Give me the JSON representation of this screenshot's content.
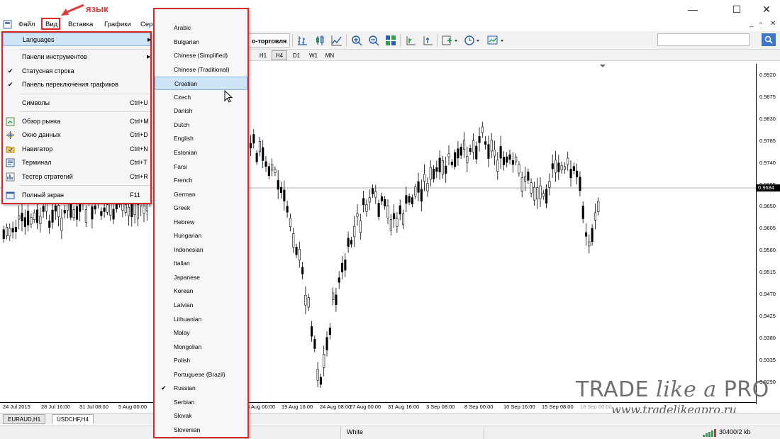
{
  "window": {
    "controls": [
      "—",
      "☐",
      "✕"
    ]
  },
  "menubar": {
    "items": [
      "Файл",
      "Вид",
      "Вставка",
      "Графики",
      "Сер"
    ],
    "mdi_controls": [
      "_",
      "▫",
      "✕"
    ]
  },
  "toolbar": {
    "algo_trading_label": "о-торговля",
    "search_placeholder": ""
  },
  "timeframes": [
    "H1",
    "H4",
    "D1",
    "W1",
    "MN"
  ],
  "active_timeframe": "H4",
  "view_menu": {
    "items": [
      {
        "label": "Languages",
        "shortcut": "",
        "submenu": true,
        "checked": false,
        "highlight": true
      },
      {
        "label": "Панели инструментов",
        "shortcut": "",
        "submenu": true,
        "checked": false
      },
      {
        "label": "Статусная строка",
        "shortcut": "",
        "submenu": false,
        "checked": true
      },
      {
        "label": "Панель переключения графиков",
        "shortcut": "",
        "submenu": false,
        "checked": true
      },
      {
        "label": "Символы",
        "shortcut": "Ctrl+U",
        "submenu": false,
        "checked": false
      },
      {
        "label": "Обзор рынка",
        "shortcut": "Ctrl+M",
        "submenu": false,
        "checked": false,
        "icon": "market-watch-icon"
      },
      {
        "label": "Окно данных",
        "shortcut": "Ctrl+D",
        "submenu": false,
        "checked": false,
        "icon": "data-window-icon"
      },
      {
        "label": "Навигатор",
        "shortcut": "Ctrl+N",
        "submenu": false,
        "checked": false,
        "icon": "navigator-icon"
      },
      {
        "label": "Терминал",
        "shortcut": "Ctrl+T",
        "submenu": false,
        "checked": false,
        "icon": "terminal-icon"
      },
      {
        "label": "Тестер стратегий",
        "shortcut": "Ctrl+R",
        "submenu": false,
        "checked": false,
        "icon": "strategy-tester-icon"
      },
      {
        "label": "Полный экран",
        "shortcut": "F11",
        "submenu": false,
        "checked": false,
        "icon": "fullscreen-icon"
      }
    ]
  },
  "languages_menu": {
    "items": [
      "Arabic",
      "Bulgarian",
      "Chinese (Simplified)",
      "Chinese (Traditional)",
      "Croatian",
      "Czech",
      "Danish",
      "Dutch",
      "English",
      "Estonian",
      "Farsi",
      "French",
      "German",
      "Greek",
      "Hebrew",
      "Hungarian",
      "Indonesian",
      "Italian",
      "Japanese",
      "Korean",
      "Latvian",
      "Lithuanian",
      "Malay",
      "Mongolian",
      "Polish",
      "Portuguese (Brazil)",
      "Russian",
      "Serbian",
      "Slovak",
      "Slovenian"
    ],
    "hovered": "Croatian",
    "checked": "Russian"
  },
  "annotation": {
    "label": "язык",
    "color": "#e23b3b"
  },
  "chart": {
    "price_ticks": [
      "0.9920",
      "0.9875",
      "0.9830",
      "0.9785",
      "0.9740",
      "0.9695",
      "0.9650",
      "0.9605",
      "0.9560",
      "0.9515",
      "0.9470",
      "0.9425",
      "0.9380",
      "0.9335",
      "0.9290"
    ],
    "current_price": "0.9684",
    "date_ticks": [
      "24 Jul 2015",
      "28 Jul 16:00",
      "31 Jul 08:00",
      "5 Aug 00:00",
      "3 Aug 00:00",
      "19 Aug 16:00",
      "24 Aug 08:00",
      "27 Aug 00:00",
      "31 Aug 16:00",
      "3 Sep 08:00",
      "8 Sep 00:00",
      "10 Sep 16:00",
      "15 Sep 08:00",
      "18 Sep 00:00"
    ]
  },
  "chart_tabs": [
    "EURAUD,H1",
    "USDCHF,H4"
  ],
  "active_chart_tab": "USDCHF,H4",
  "statusbar": {
    "profile": "White",
    "traffic": "30400/2 kb"
  },
  "watermark": {
    "brand_a": "TRADE",
    "brand_b": "like a",
    "brand_c": "PRO",
    "url": "www.tradelikeapro.ru"
  },
  "colors": {
    "annotation_red": "#d62a2a",
    "highlight": "#cfe4f7",
    "accent_blue": "#2d5fa8"
  }
}
